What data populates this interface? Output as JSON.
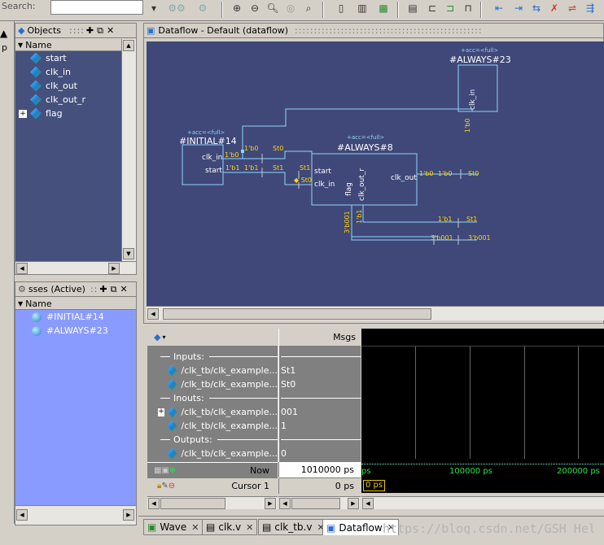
{
  "toolbar": {
    "search_label": "Search:"
  },
  "objects_panel": {
    "title": "Objects",
    "column_name": "Name",
    "items": [
      {
        "label": "start"
      },
      {
        "label": "clk_in"
      },
      {
        "label": "clk_out"
      },
      {
        "label": "clk_out_r"
      },
      {
        "label": "flag"
      }
    ]
  },
  "processes_panel": {
    "title": "sses (Active)",
    "column_name": "Name",
    "items": [
      {
        "label": "#INITIAL#14"
      },
      {
        "label": "#ALWAYS#23"
      }
    ]
  },
  "dataflow": {
    "title": "Dataflow - Default  (dataflow)",
    "blocks": {
      "initial": {
        "tag": "+acc=<full>",
        "name": "#INITIAL#14",
        "ports": [
          "clk_in",
          "start"
        ]
      },
      "always8": {
        "tag": "+acc=<full>",
        "name": "#ALWAYS#8",
        "in_ports": [
          "start",
          "clk_in"
        ],
        "out_port": "clk_out",
        "bottom_ports": [
          "flag",
          "clk_out_r"
        ]
      },
      "always23": {
        "tag": "+acc=<full>",
        "name": "#ALWAYS#23",
        "port": "clk_in"
      }
    },
    "labels": {
      "l1b0a": "1'b0",
      "l1b0b": "1'b0",
      "st0a": "St0",
      "l1b1a": "1'b1",
      "l1b1b": "1'b1",
      "st1a": "St1",
      "st1b": "St1",
      "st0b": "St0",
      "v1b0": "1'b0",
      "o1b0a": "1'b0",
      "o1b0b": "1'b0",
      "ost0": "St0",
      "v3b001": "3'b001",
      "v1b1": "1'b1",
      "b1b1": "1'b1",
      "bst1": "St1",
      "b3a": "3'b001",
      "b3b": "3'b001"
    }
  },
  "wave": {
    "msgs_header": "Msgs",
    "rows": [
      {
        "type": "group",
        "label": "Inputs:",
        "value": ""
      },
      {
        "type": "sig",
        "label": "/clk_tb/clk_example...",
        "value": "St1"
      },
      {
        "type": "sig",
        "label": "/clk_tb/clk_example...",
        "value": "St0"
      },
      {
        "type": "group",
        "label": "Inouts:",
        "value": ""
      },
      {
        "type": "sig",
        "label": "/clk_tb/clk_example...",
        "value": "001",
        "expand": true
      },
      {
        "type": "sig",
        "label": "/clk_tb/clk_example...",
        "value": "1"
      },
      {
        "type": "group",
        "label": "Outputs:",
        "value": ""
      },
      {
        "type": "sig",
        "label": "/clk_tb/clk_example...",
        "value": "0"
      }
    ],
    "now_label": "Now",
    "now_value": "1010000 ps",
    "cursor_label": "Cursor 1",
    "cursor_value": "0 ps",
    "time_ticks": [
      "ps",
      "100000 ps",
      "200000 ps"
    ],
    "cursor_box": "0 ps"
  },
  "tabs": [
    {
      "label": "Wave"
    },
    {
      "label": "clk.v"
    },
    {
      "label": "clk_tb.v"
    },
    {
      "label": "Dataflow"
    }
  ],
  "watermark": "https://blog.csdn.net/GSH_Hello_World"
}
